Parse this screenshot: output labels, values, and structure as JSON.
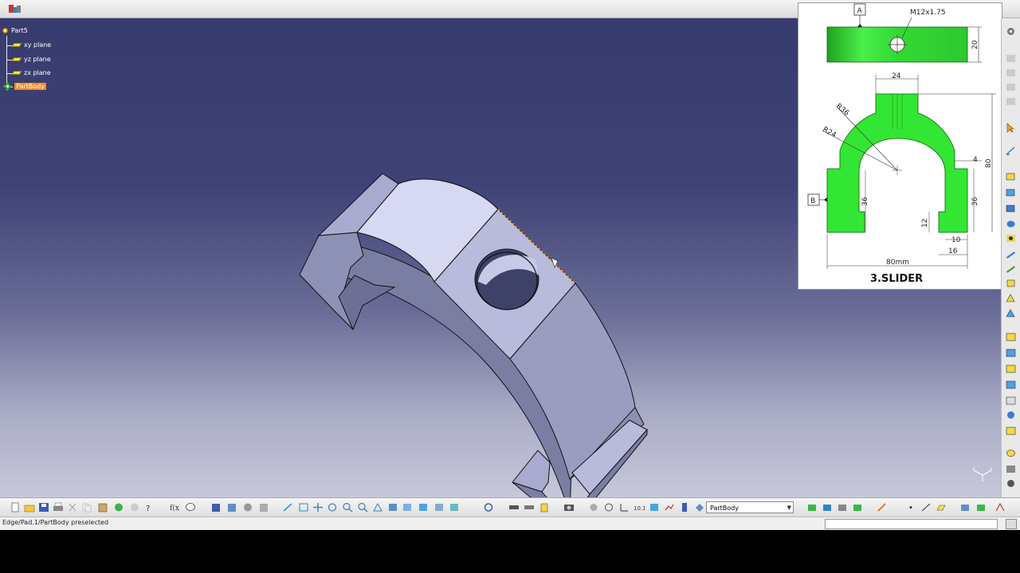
{
  "tree": {
    "root": "Part5",
    "items": [
      "xy plane",
      "yz plane",
      "zx plane"
    ],
    "body": "PartBody"
  },
  "drawing": {
    "title": "3.SLIDER",
    "thread": "M12x1.75",
    "datum_a": "A",
    "datum_b": "B",
    "dims": {
      "top_height": "20",
      "neck_width": "24",
      "outer_radius": "R36",
      "inner_radius": "R24",
      "total_height": "80",
      "wall_step": "4",
      "left_leg": "36",
      "right_leg": "36",
      "slot_height": "12",
      "slot_width": "10",
      "leg_width": "16",
      "total_width": "80mm"
    }
  },
  "toolbar": {
    "body_selector": "PartBody"
  },
  "status": {
    "message": "Edge/Pad.1/PartBody preselected"
  },
  "colors": {
    "viewport_top": "#383b6e",
    "viewport_bottom": "#c7c8d9",
    "part_green": "#33e633",
    "highlight_orange": "#f08a1c"
  }
}
